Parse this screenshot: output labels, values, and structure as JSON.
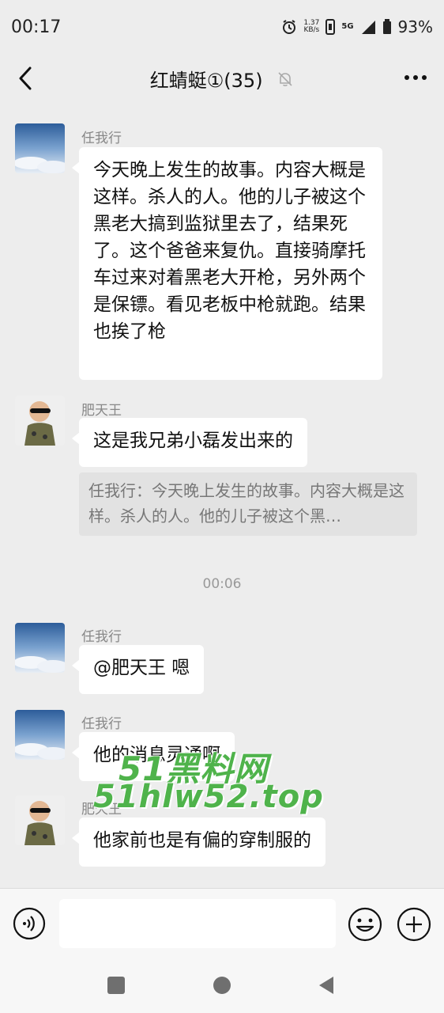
{
  "status_bar": {
    "time": "00:17",
    "net_speed_value": "1.37",
    "net_speed_unit": "KB/s",
    "network": "5G",
    "battery": "93%"
  },
  "header": {
    "title": "红蜻蜓①(35)"
  },
  "messages": [
    {
      "sender": "任我行",
      "text": "今天晚上发生的故事。内容大概是这样。杀人的人。他的儿子被这个黑老大搞到监狱里去了，结果死了。这个爸爸来复仇。直接骑摩托车过来对着黑老大开枪，另外两个是保镖。看见老板中枪就跑。结果也挨了枪"
    },
    {
      "sender": "肥天王",
      "text": "这是我兄弟小磊发出来的",
      "quote": "任我行：今天晚上发生的故事。内容大概是这样。杀人的人。他的儿子被这个黑…"
    },
    {
      "sender": "任我行",
      "text": "@肥天王  嗯"
    },
    {
      "sender": "任我行",
      "text": "他的消息灵通啊"
    },
    {
      "sender": "肥天王",
      "text": "他家前也是有偏的穿制服的"
    }
  ],
  "time_separator": "00:06",
  "watermark": {
    "line1": "51黑料网",
    "line2": "51hlw52.top",
    "color": "#4fb34b"
  },
  "icons": {
    "back": "chevron-left-icon",
    "mute": "bell-off-icon",
    "more": "ellipsis-icon",
    "voice": "voice-icon",
    "emoji": "smiley-icon",
    "plus": "plus-circle-icon"
  },
  "colors": {
    "background": "#ededed",
    "bubble": "#ffffff",
    "quote_bg": "#e2e2e2"
  }
}
